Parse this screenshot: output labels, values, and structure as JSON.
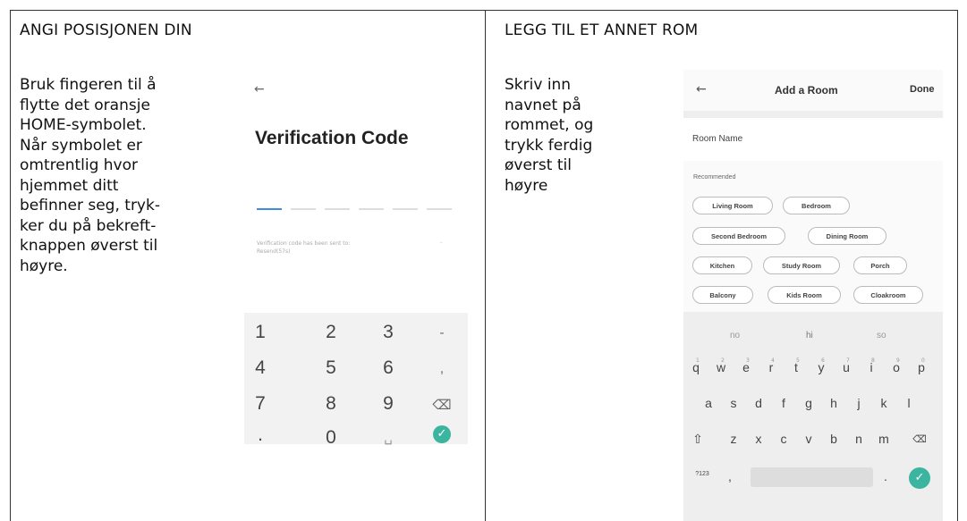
{
  "left": {
    "heading": "ANGI POSISJONEN DIN",
    "body": "Bruk fingeren til å\nflytte det oransje\nHOME-symbolet.\nNår symbolet er\nomtrentlig hvor\nhjemmet ditt\nbefinner seg, tryk-\nker du på bekreft-\nknappen øverst til\nhøyre.",
    "phone": {
      "back": "←",
      "title": "Verification Code",
      "note": "Verification code has been sent to:\nResend(57s)",
      "dash": "-",
      "keys": [
        "1",
        "2",
        "3",
        "-",
        "4",
        "5",
        "6",
        ",",
        "7",
        "8",
        "9",
        "⌫",
        ".",
        "0",
        "␣",
        "✓"
      ]
    }
  },
  "right": {
    "heading": "LEGG TIL ET ANNET ROM",
    "body": "Skriv inn\nnavnet på\nrommet, og\ntrykk ferdig\nøverst til\nhøyre",
    "phone": {
      "back": "←",
      "title": "Add a Room",
      "done": "Done",
      "field_label": "Room Name",
      "recommended_label": "Recommended",
      "chips": [
        "Living Room",
        "Bedroom",
        "Second Bedroom",
        "Dining Room",
        "Kitchen",
        "Study Room",
        "Porch",
        "Balcony",
        "Kids Room",
        "Cloakroom"
      ],
      "suggestions": [
        "no",
        "hi",
        "so"
      ],
      "row1": [
        "q",
        "w",
        "e",
        "r",
        "t",
        "y",
        "u",
        "i",
        "o",
        "p"
      ],
      "row1_hints": [
        "1",
        "2",
        "3",
        "4",
        "5",
        "6",
        "7",
        "8",
        "9",
        "0"
      ],
      "row2": [
        "a",
        "s",
        "d",
        "f",
        "g",
        "h",
        "j",
        "k",
        "l"
      ],
      "row3": [
        "z",
        "x",
        "c",
        "v",
        "b",
        "n",
        "m"
      ],
      "shift": "⇧",
      "backspace": "⌫",
      "sym": "?123",
      "comma": ",",
      "period": ".",
      "enter": "✓"
    }
  }
}
